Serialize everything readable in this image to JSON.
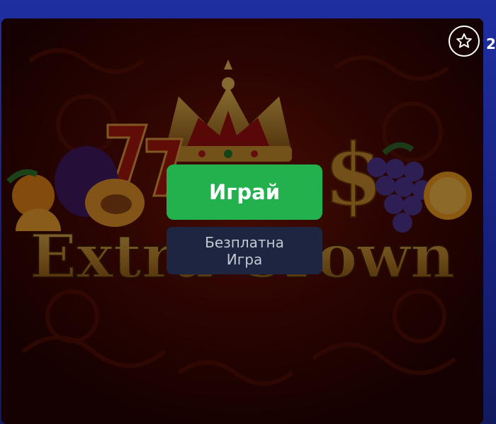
{
  "game_tile": {
    "artwork_title": "Extra Crown",
    "play_label": "Играй",
    "demo_label": "Безплатна Игра",
    "favorite_icon": "star-outline-icon"
  },
  "colors": {
    "play_button": "#22b14c",
    "demo_button": "#1d2540",
    "page_background": "#1c2a8c",
    "tile_background": "#2a0503"
  }
}
